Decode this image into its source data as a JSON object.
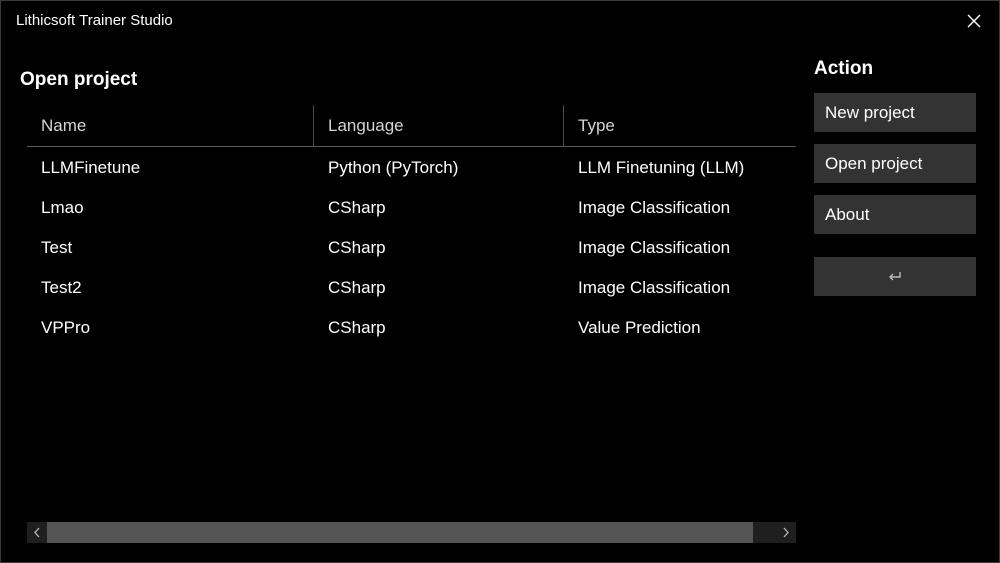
{
  "window": {
    "title": "Lithicsoft Trainer Studio"
  },
  "open_project": {
    "title": "Open project",
    "columns": [
      "Name",
      "Language",
      "Type"
    ],
    "rows": [
      {
        "name": "LLMFinetune",
        "language": "Python (PyTorch)",
        "type": "LLM Finetuning (LLM)"
      },
      {
        "name": "Lmao",
        "language": "CSharp",
        "type": "Image Classification"
      },
      {
        "name": "Test",
        "language": "CSharp",
        "type": "Image Classification"
      },
      {
        "name": "Test2",
        "language": "CSharp",
        "type": "Image Classification"
      },
      {
        "name": "VPPro",
        "language": "CSharp",
        "type": "Value Prediction"
      }
    ]
  },
  "actions": {
    "title": "Action",
    "new_project": "New project",
    "open_project": "Open project",
    "about": "About",
    "back_icon": "return-arrow-icon"
  },
  "icons": {
    "close": "close-icon",
    "scroll_left": "chevron-left-icon",
    "scroll_right": "chevron-right-icon"
  },
  "colors": {
    "background": "#000000",
    "button": "#333333",
    "scroll_track": "#1f1f1f",
    "scroll_thumb": "#555555",
    "header_text": "#d4d4d4"
  }
}
